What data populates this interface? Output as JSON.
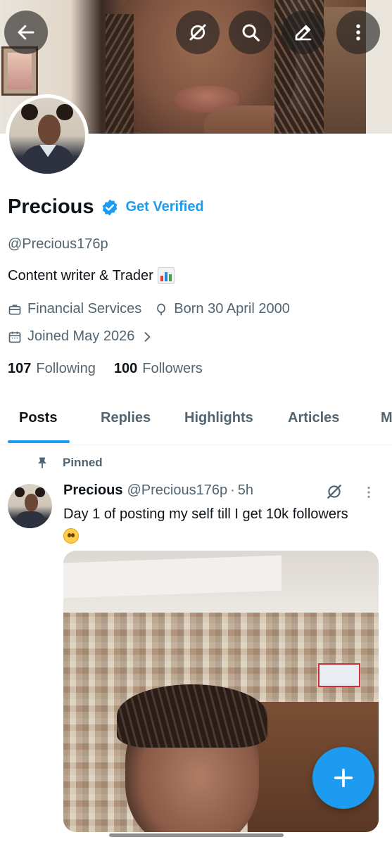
{
  "header": {
    "back_icon": "arrow-left-icon",
    "grok_icon": "grok-slash-icon",
    "search_icon": "search-icon",
    "edit_icon": "pencil-icon",
    "more_icon": "more-vertical-icon"
  },
  "profile": {
    "name": "Precious",
    "verified_icon": "verified-badge-icon",
    "get_verified_label": "Get Verified",
    "handle": "@Precious176p",
    "bio": "Content writer & Trader",
    "bio_emoji": "bar-chart-emoji",
    "category": "Financial Services",
    "birth": "Born 30 April 2000",
    "joined": "Joined May 2026",
    "following_count": "107",
    "following_label": "Following",
    "followers_count": "100",
    "followers_label": "Followers"
  },
  "tabs": [
    {
      "label": "Posts",
      "active": true
    },
    {
      "label": "Replies",
      "active": false
    },
    {
      "label": "Highlights",
      "active": false
    },
    {
      "label": "Articles",
      "active": false
    },
    {
      "label": "M",
      "active": false
    }
  ],
  "pinned_post": {
    "pinned_label": "Pinned",
    "author_name": "Precious",
    "author_handle": "@Precious176p",
    "separator": "·",
    "time": "5h",
    "text": "Day 1 of posting my self till I get 10k followers",
    "emoji": "pleading-face-emoji"
  },
  "fab": {
    "icon": "plus-icon"
  },
  "colors": {
    "accent": "#1d9bf0",
    "text_primary": "#0f1419",
    "text_secondary": "#536471"
  }
}
